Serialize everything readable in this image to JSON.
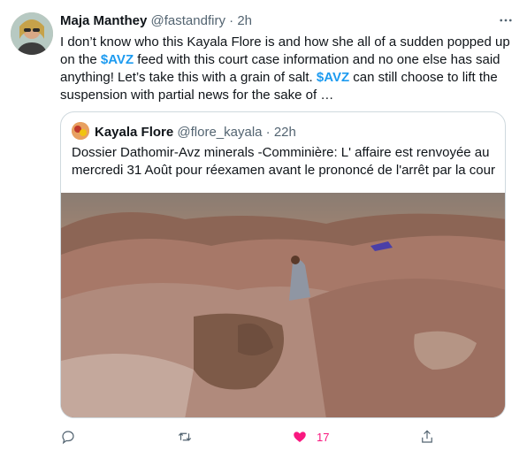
{
  "tweet": {
    "author_name": "Maja Manthey",
    "author_handle": "@fastandfiry",
    "separator": "·",
    "time": "2h",
    "text_parts": [
      {
        "t": "I don’t know who this Kayala Flore is and how she all of a sudden popped up on the ",
        "cash": false
      },
      {
        "t": "$AVZ",
        "cash": true
      },
      {
        "t": " feed with this court case information and no one else has said anything! Let’s take this with a grain of salt. ",
        "cash": false
      },
      {
        "t": "$AVZ",
        "cash": true
      },
      {
        "t": " can still choose to lift the suspension with partial news for the sake of …",
        "cash": false
      }
    ]
  },
  "quoted": {
    "author_name": "Kayala Flore",
    "author_handle": "@flore_kayala",
    "separator": "·",
    "time": "22h",
    "text": "Dossier Dathomir-Avz minerals -Comminière: L' affaire est renvoyée au mercredi 31 Août pour réexamen avant le prononcé de l'arrêt par la cour"
  },
  "actions": {
    "reply_count": "",
    "retweet_count": "",
    "like_count": "17",
    "liked": true
  },
  "colors": {
    "accent": "#1d9bf0",
    "like": "#f91880",
    "muted": "#536471",
    "border": "#cfd9de"
  },
  "icons": [
    "more-icon",
    "reply-icon",
    "retweet-icon",
    "heart-icon",
    "share-icon"
  ]
}
